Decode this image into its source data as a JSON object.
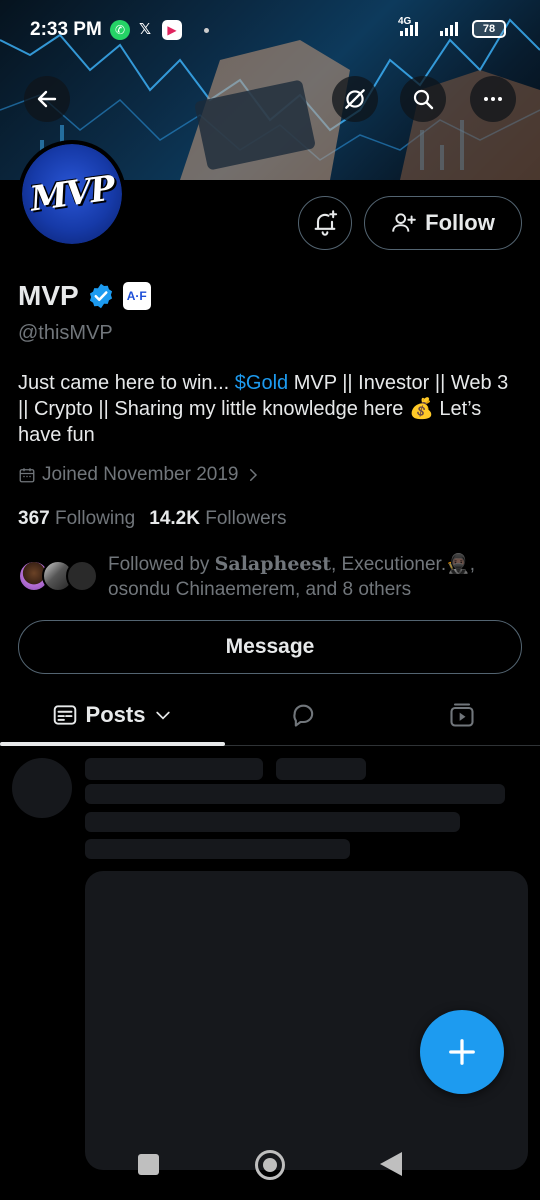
{
  "status_bar": {
    "time": "2:33 PM",
    "network": "4G",
    "battery": "78"
  },
  "header": {
    "back_icon": "arrow-left-icon",
    "grok_icon": "grok-icon",
    "search_icon": "search-icon",
    "more_icon": "more-horizontal-icon"
  },
  "profile": {
    "name": "MVP",
    "affiliate_badge": "A·F",
    "handle": "@thisMVP",
    "bio_before": "Just came here to win... ",
    "bio_cashtag": "$Gold",
    "bio_after": " MVP || Investor || Web 3 || Crypto || Sharing my little knowledge here 💰 Let’s have fun",
    "joined": "Joined November 2019",
    "following_count": "367",
    "following_label": "Following",
    "followers_count": "14.2K",
    "followers_label": "Followers",
    "followed_by_prefix": "Followed by ",
    "followed_by_name1": "𝐒𝐚𝐥𝐚𝐩𝐡𝐞𝐞𝐬𝐭",
    "followed_by_rest": ", Executioner.🥷🏿, osondu Chinaemerem, and 8 others"
  },
  "actions": {
    "follow_label": "Follow",
    "message_label": "Message"
  },
  "tabs": {
    "posts_label": "Posts"
  },
  "colors": {
    "accent": "#1d9bf0",
    "background": "#000000",
    "muted_text": "#71767b"
  }
}
